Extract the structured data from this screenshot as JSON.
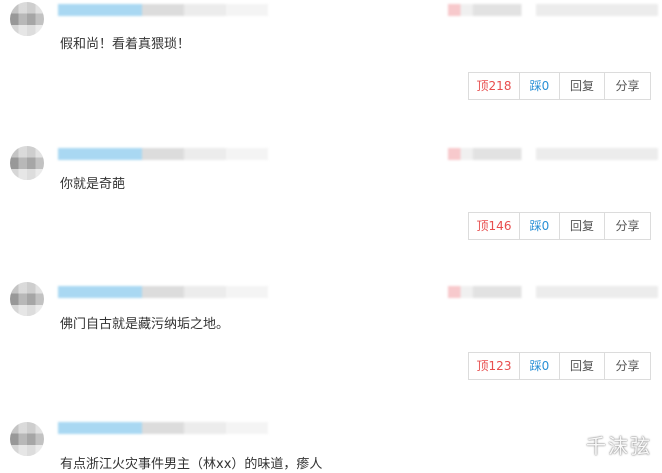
{
  "comments": [
    {
      "text": "假和尚！看着真猥琐！",
      "actions": {
        "up": "顶218",
        "down": "踩0",
        "reply": "回复",
        "share": "分享"
      }
    },
    {
      "text": "你就是奇葩",
      "actions": {
        "up": "顶146",
        "down": "踩0",
        "reply": "回复",
        "share": "分享"
      }
    },
    {
      "text": "佛门自古就是藏污纳垢之地。",
      "actions": {
        "up": "顶123",
        "down": "踩0",
        "reply": "回复",
        "share": "分享"
      }
    },
    {
      "text": "有点浙江火灾事件男主（林xx）的味道，瘆人"
    }
  ],
  "watermark": "千沫弦"
}
